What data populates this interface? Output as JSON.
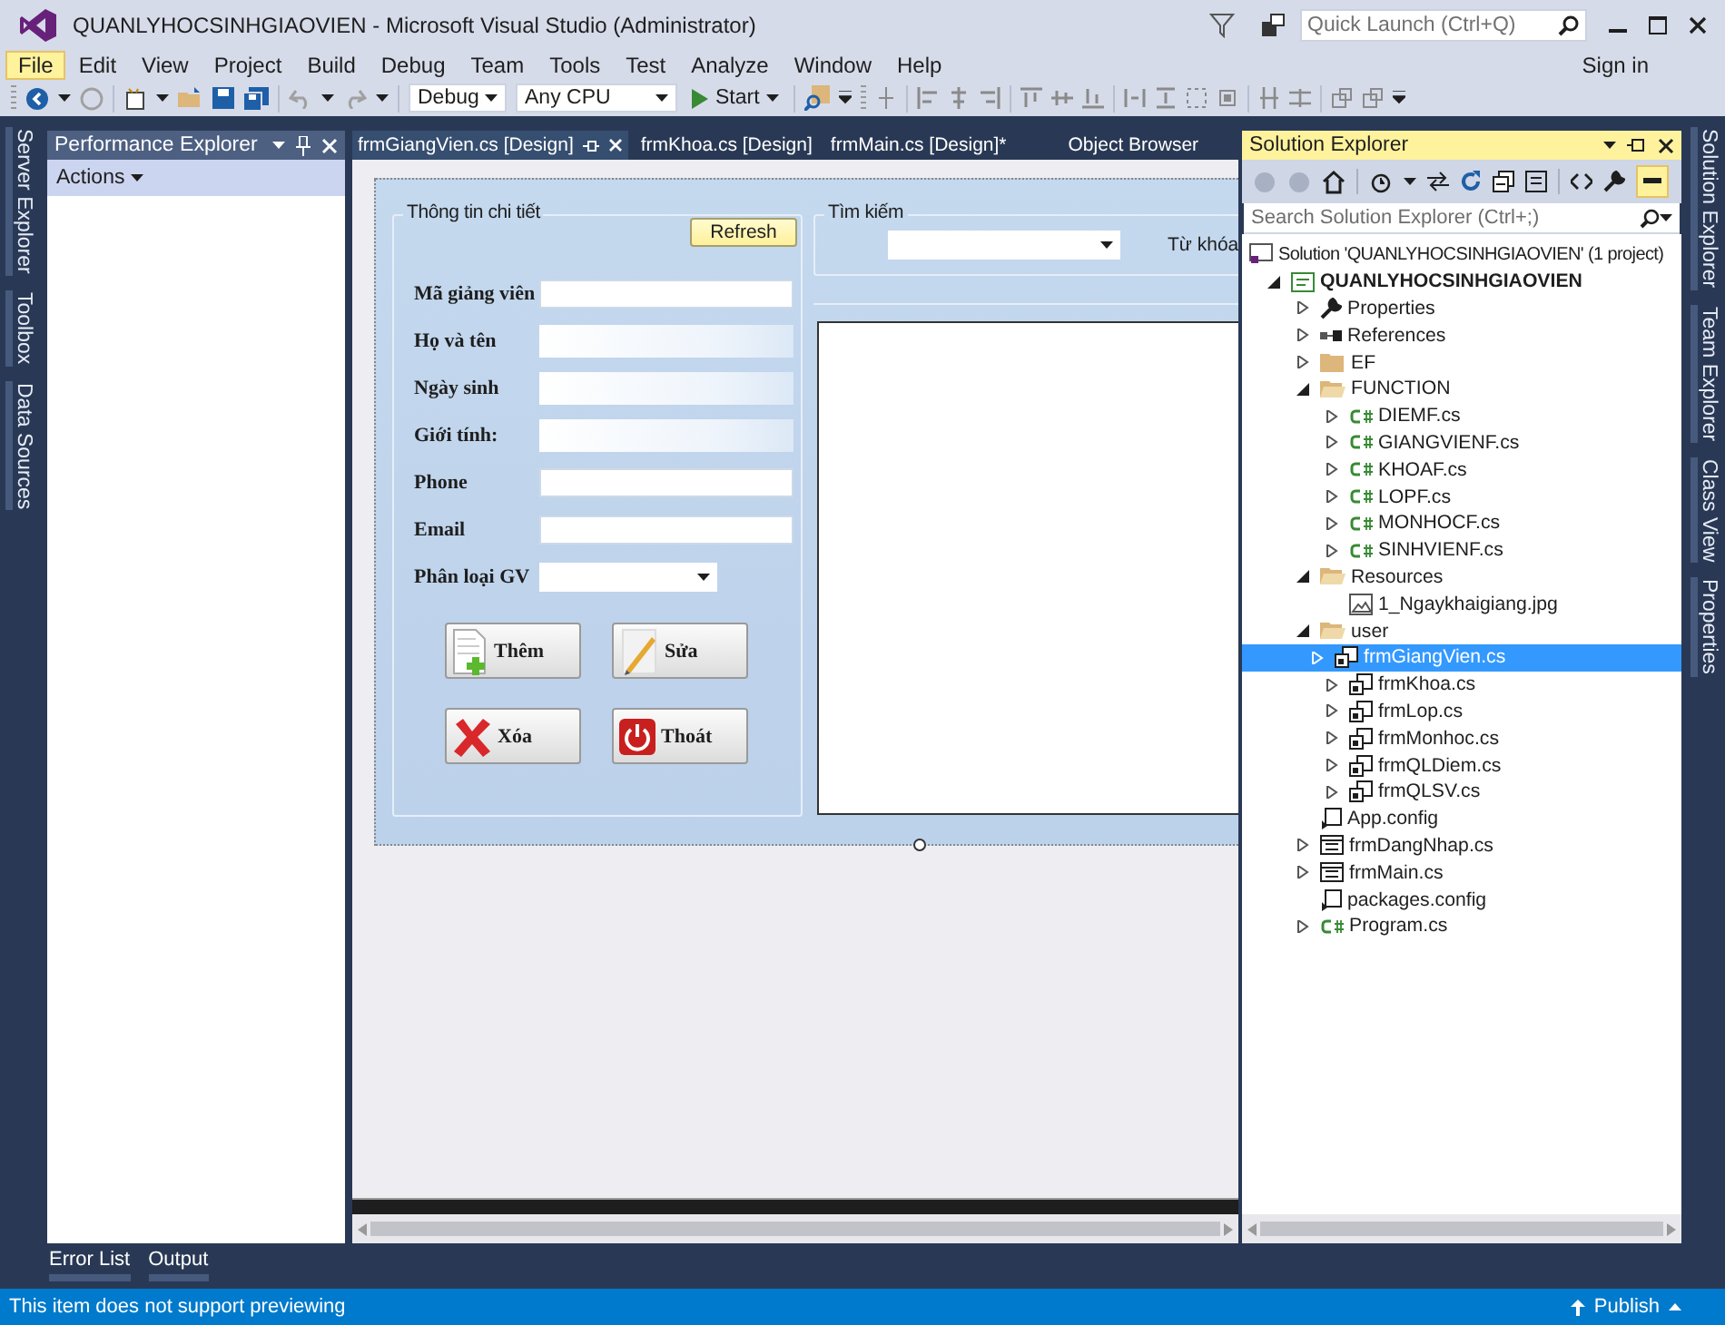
{
  "window": {
    "title": "QUANLYHOCSINHGIAOVIEN - Microsoft Visual Studio (Administrator)",
    "quick_launch": {
      "placeholder": "Quick Launch (Ctrl+Q)"
    },
    "sign_in": "Sign in"
  },
  "menu": [
    {
      "label": "File",
      "selected": true
    },
    {
      "label": "Edit",
      "selected": false
    },
    {
      "label": "View",
      "selected": false
    },
    {
      "label": "Project",
      "selected": false
    },
    {
      "label": "Build",
      "selected": false
    },
    {
      "label": "Debug",
      "selected": false
    },
    {
      "label": "Team",
      "selected": false
    },
    {
      "label": "Tools",
      "selected": false
    },
    {
      "label": "Test",
      "selected": false
    },
    {
      "label": "Analyze",
      "selected": false
    },
    {
      "label": "Window",
      "selected": false
    },
    {
      "label": "Help",
      "selected": false
    }
  ],
  "toolbar": {
    "configuration": "Debug",
    "platform": "Any CPU",
    "start": "Start"
  },
  "left_tabs": [
    "Server Explorer",
    "Toolbox",
    "Data Sources"
  ],
  "performance_explorer": {
    "title": "Performance Explorer",
    "actions": "Actions"
  },
  "document_tabs": [
    {
      "label": "frmGiangVien.cs [Design]",
      "selected": true
    },
    {
      "label": "frmKhoa.cs [Design]",
      "selected": false
    },
    {
      "label": "frmMain.cs [Design]*",
      "selected": false
    },
    {
      "label": "Object Browser",
      "selected": false
    }
  ],
  "form": {
    "details": {
      "title": "Thông tin chi tiết",
      "refresh": "Refresh",
      "fields": [
        {
          "label": "Mã giảng viên",
          "kind": "text"
        },
        {
          "label": "Họ và tên",
          "kind": "blurred"
        },
        {
          "label": "Ngày sinh",
          "kind": "blurred"
        },
        {
          "label": "Giới tính:",
          "kind": "blurred"
        },
        {
          "label": "Phone",
          "kind": "text"
        },
        {
          "label": "Email",
          "kind": "text"
        },
        {
          "label": "Phân loại GV",
          "kind": "dropdown"
        }
      ],
      "buttons": [
        {
          "label": "Thêm",
          "kind": "add"
        },
        {
          "label": "Sửa",
          "kind": "edit"
        },
        {
          "label": "Xóa",
          "kind": "delete"
        },
        {
          "label": "Thoát",
          "kind": "exit"
        }
      ]
    },
    "search": {
      "title": "Tìm kiếm",
      "keyword_label": "Từ khóa"
    }
  },
  "solution_explorer": {
    "title": "Solution Explorer",
    "search": {
      "placeholder": "Search Solution Explorer (Ctrl+;)"
    },
    "tree": [
      {
        "label": "Solution 'QUANLYHOCSINHGIAOVIEN' (1 project)",
        "kind": "solution",
        "selected": false,
        "children": [
          {
            "label": "QUANLYHOCSINHGIAOVIEN",
            "kind": "project",
            "expanded": true,
            "selected": false,
            "children": [
              {
                "label": "Properties",
                "kind": "properties",
                "expanded": false,
                "selected": false
              },
              {
                "label": "References",
                "kind": "references",
                "expanded": false,
                "selected": false
              },
              {
                "label": "EF",
                "kind": "folder",
                "expanded": false,
                "selected": false
              },
              {
                "label": "FUNCTION",
                "kind": "folder",
                "expanded": true,
                "selected": false,
                "children": [
                  {
                    "label": "DIEMF.cs",
                    "kind": "csharp",
                    "expanded": false,
                    "selected": false
                  },
                  {
                    "label": "GIANGVIENF.cs",
                    "kind": "csharp",
                    "expanded": false,
                    "selected": false
                  },
                  {
                    "label": "KHOAF.cs",
                    "kind": "csharp",
                    "expanded": false,
                    "selected": false
                  },
                  {
                    "label": "LOPF.cs",
                    "kind": "csharp",
                    "expanded": false,
                    "selected": false
                  },
                  {
                    "label": "MONHOCF.cs",
                    "kind": "csharp",
                    "expanded": false,
                    "selected": false
                  },
                  {
                    "label": "SINHVIENF.cs",
                    "kind": "csharp",
                    "expanded": false,
                    "selected": false
                  }
                ]
              },
              {
                "label": "Resources",
                "kind": "folder",
                "expanded": true,
                "selected": false,
                "children": [
                  {
                    "label": "1_Ngaykhaigiang.jpg",
                    "kind": "image",
                    "selected": false
                  }
                ]
              },
              {
                "label": "user",
                "kind": "folder",
                "expanded": true,
                "selected": false,
                "children": [
                  {
                    "label": "frmGiangVien.cs",
                    "kind": "usercontrol",
                    "expanded": false,
                    "selected": true
                  },
                  {
                    "label": "frmKhoa.cs",
                    "kind": "usercontrol",
                    "expanded": false,
                    "selected": false
                  },
                  {
                    "label": "frmLop.cs",
                    "kind": "usercontrol",
                    "expanded": false,
                    "selected": false
                  },
                  {
                    "label": "frmMonhoc.cs",
                    "kind": "usercontrol",
                    "expanded": false,
                    "selected": false
                  },
                  {
                    "label": "frmQLDiem.cs",
                    "kind": "usercontrol",
                    "expanded": false,
                    "selected": false
                  },
                  {
                    "label": "frmQLSV.cs",
                    "kind": "usercontrol",
                    "expanded": false,
                    "selected": false
                  }
                ]
              },
              {
                "label": "App.config",
                "kind": "config",
                "selected": false
              },
              {
                "label": "frmDangNhap.cs",
                "kind": "form",
                "expanded": false,
                "selected": false
              },
              {
                "label": "frmMain.cs",
                "kind": "form",
                "expanded": false,
                "selected": false
              },
              {
                "label": "packages.config",
                "kind": "config",
                "selected": false
              },
              {
                "label": "Program.cs",
                "kind": "csharp",
                "expanded": false,
                "selected": false
              }
            ]
          }
        ]
      }
    ]
  },
  "right_tabs": [
    "Solution Explorer",
    "Team Explorer",
    "Class View",
    "Properties"
  ],
  "bottom_tabs": [
    "Error List",
    "Output"
  ],
  "status_bar": {
    "message": "This item does not support previewing",
    "publish": "Publish"
  }
}
